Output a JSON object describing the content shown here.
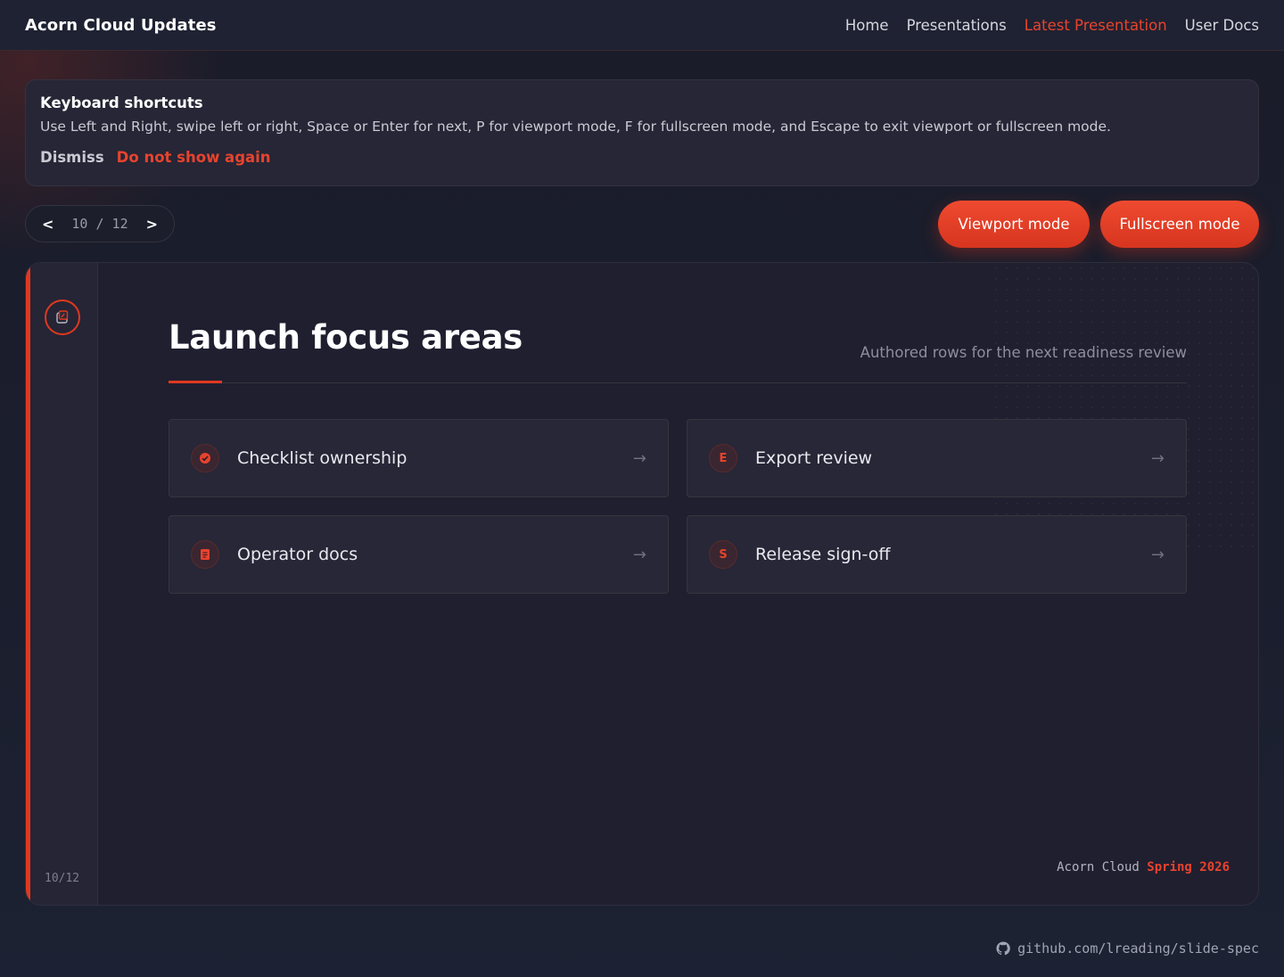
{
  "header": {
    "brand": "Acorn Cloud Updates",
    "nav": [
      {
        "label": "Home",
        "active": false
      },
      {
        "label": "Presentations",
        "active": false
      },
      {
        "label": "Latest Presentation",
        "active": true
      },
      {
        "label": "User Docs",
        "active": false
      }
    ]
  },
  "notice": {
    "title": "Keyboard shortcuts",
    "text": "Use Left and Right, swipe left or right, Space or Enter for next, P for viewport mode, F for fullscreen mode, and Escape to exit viewport or fullscreen mode.",
    "dismiss_label": "Dismiss",
    "dont_show_label": "Do not show again"
  },
  "pager": {
    "prev_label": "<",
    "next_label": ">",
    "count": "10 / 12"
  },
  "modes": {
    "viewport_label": "Viewport mode",
    "fullscreen_label": "Fullscreen mode"
  },
  "slide": {
    "title": "Launch focus areas",
    "subtitle": "Authored rows for the next readiness review",
    "page_indicator": "10/12",
    "cards": [
      {
        "label": "Checklist ownership",
        "icon": "check-circle-icon",
        "glyph": ""
      },
      {
        "label": "Export review",
        "icon": "letter-e-icon",
        "glyph": "E"
      },
      {
        "label": "Operator docs",
        "icon": "document-icon",
        "glyph": ""
      },
      {
        "label": "Release sign-off",
        "icon": "letter-s-icon",
        "glyph": "S"
      }
    ],
    "arrow_glyph": "→",
    "footer_brand": "Acorn Cloud",
    "footer_season": "Spring 2026"
  },
  "repo": {
    "label": "github.com/lreading/slide-spec"
  },
  "colors": {
    "accent": "#e8432d",
    "background": "#1b1d2b",
    "card": "#272737"
  }
}
